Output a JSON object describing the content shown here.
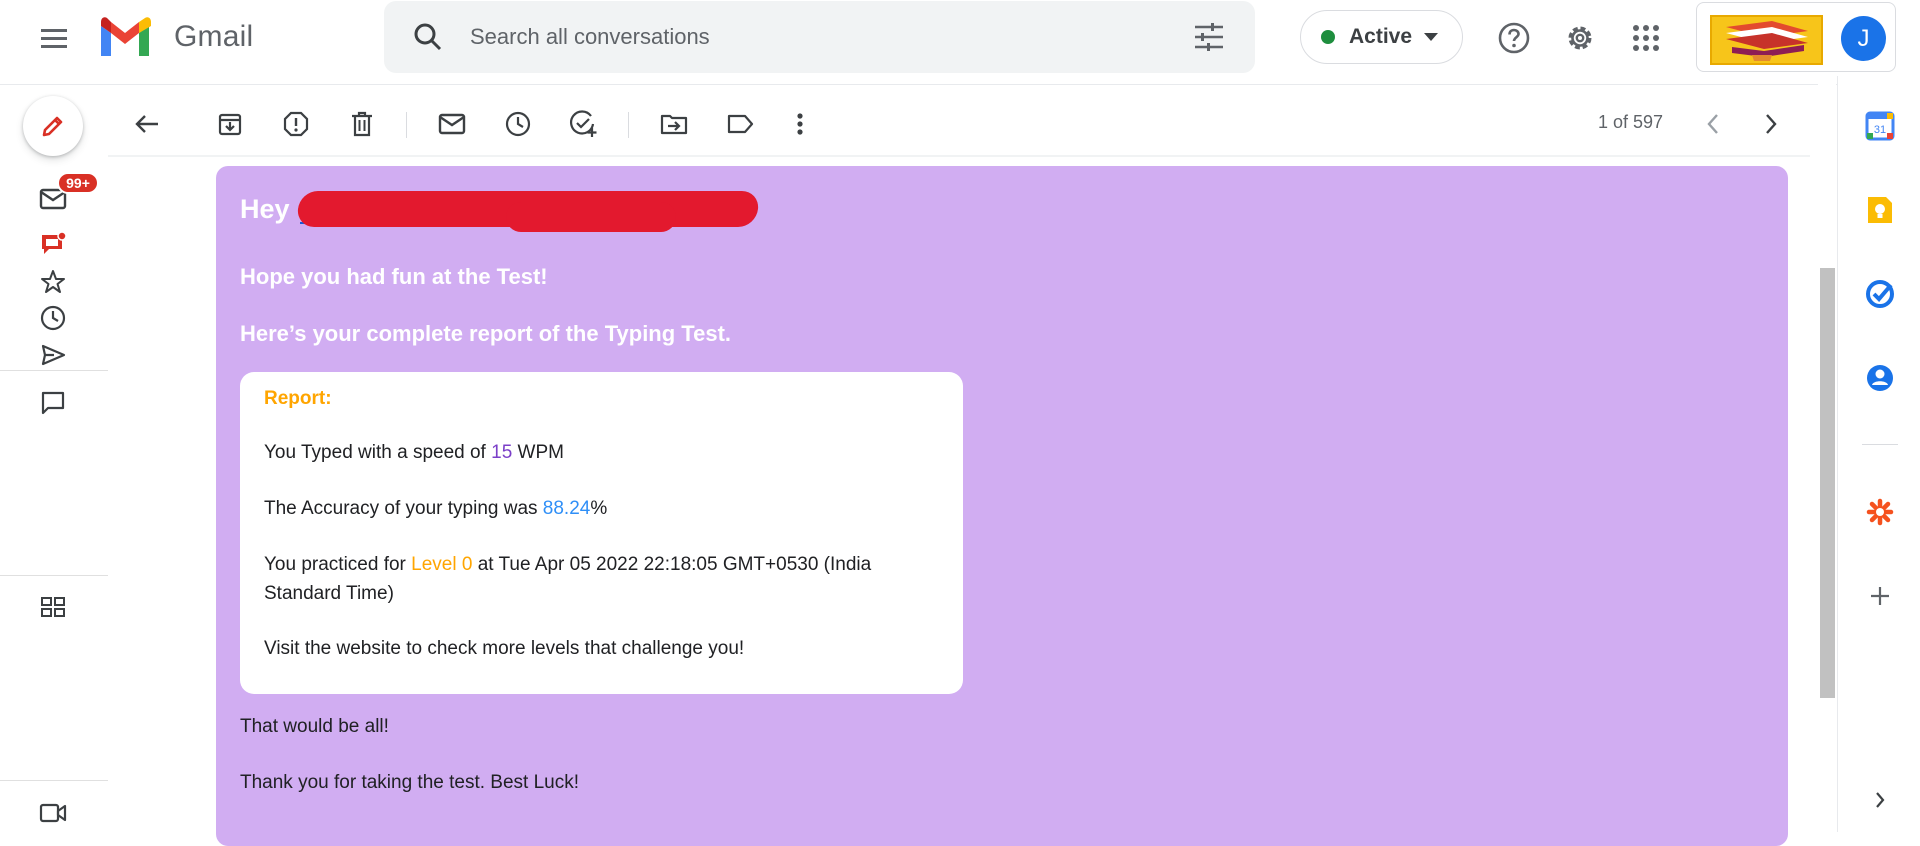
{
  "app": {
    "name": "Gmail"
  },
  "search": {
    "placeholder": "Search all conversations"
  },
  "status": {
    "label": "Active",
    "color": "#1e8e3e"
  },
  "account": {
    "avatar_letter": "J",
    "avatar_color": "#1a73e8"
  },
  "rail": {
    "mail_badge": "99+",
    "icons": [
      "compose-pencil-icon",
      "mail-icon",
      "chat-icon",
      "star-icon",
      "clock-icon",
      "send-icon",
      "chat-bubble-icon",
      "spaces-icon",
      "video-icon"
    ]
  },
  "toolbar": {
    "icons": [
      "back-arrow-icon",
      "archive-icon",
      "report-spam-icon",
      "delete-icon",
      "mark-unread-icon",
      "snooze-icon",
      "add-task-icon",
      "move-to-icon",
      "label-icon",
      "more-vert-icon"
    ],
    "pager": "1 of 597"
  },
  "email": {
    "background": "#d1adf2",
    "greeting": "Hey",
    "line1": "Hope you had fun at the Test!",
    "line2": "Here’s your complete report of the Typing Test.",
    "report": {
      "title": "Report:",
      "speed_prefix": "You Typed with a speed of ",
      "speed_value": "15",
      "speed_suffix": " WPM",
      "accuracy_prefix": "The Accuracy of your typing was ",
      "accuracy_value": "88.24",
      "accuracy_suffix": "%",
      "practice_prefix": "You practiced for ",
      "practice_level": "Level 0",
      "practice_suffix": " at Tue Apr 05 2022 22:18:05 GMT+0530 (India Standard Time)",
      "visit": "Visit the website to check more levels that challenge you!"
    },
    "closing1": "That would be all!",
    "closing2": "Thank you for taking the test. Best Luck!"
  },
  "side_panel": {
    "apps": [
      "calendar-icon",
      "keep-icon",
      "tasks-icon",
      "contacts-icon",
      "zoho-icon",
      "add-icon",
      "expand-chevron-icon"
    ],
    "calendar_day": "31"
  }
}
